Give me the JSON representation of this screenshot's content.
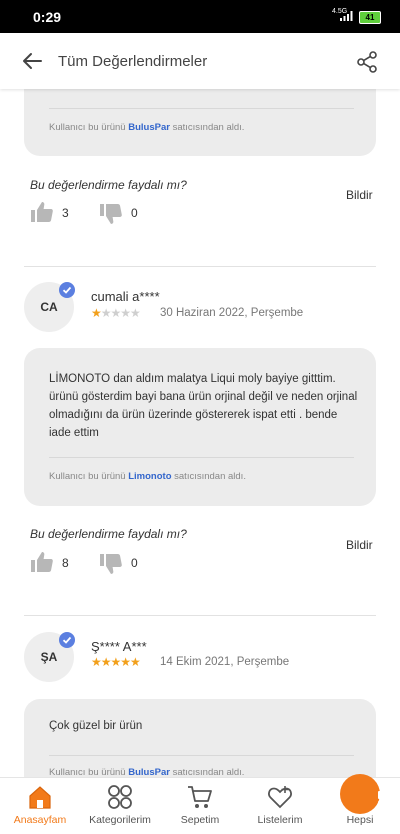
{
  "status_bar": {
    "time": "0:29",
    "network": "4.5G",
    "battery": "41"
  },
  "app_bar": {
    "title": "Tüm Değerlendirmeler"
  },
  "reviews": [
    {
      "seller_prefix": "Kullanıcı bu ürünü",
      "seller_name": "BulusPar",
      "seller_suffix": "satıcısından aldı.",
      "helpful_question": "Bu değerlendirme faydalı mı?",
      "report_label": "Bildir",
      "likes": "3",
      "dislikes": "0"
    },
    {
      "avatar": "CA",
      "author": "cumali a****",
      "rating": 1,
      "date": "30 Haziran 2022, Perşembe",
      "text": "LİMONOTO dan aldım malatya Liqui moly bayiye gitttim. ürünü gösterdim bayi bana ürün orjinal değil ve neden orjinal olmadığını da ürün üzerinde göstererek ispat etti . bende iade ettim",
      "seller_prefix": "Kullanıcı bu ürünü",
      "seller_name": "Limonoto",
      "seller_suffix": "satıcısından aldı.",
      "helpful_question": "Bu değerlendirme faydalı mı?",
      "report_label": "Bildir",
      "likes": "8",
      "dislikes": "0"
    },
    {
      "avatar": "ŞA",
      "author": "Ş**** A***",
      "rating": 5,
      "date": "14 Ekim 2021, Perşembe",
      "text": "Çok güzel bir ürün",
      "seller_prefix": "Kullanıcı bu ürünü",
      "seller_name": "BulusPar",
      "seller_suffix": "satıcısından aldı."
    }
  ],
  "bottom_nav": [
    {
      "label": "Anasayfam",
      "icon": "home-icon",
      "active": true
    },
    {
      "label": "Kategorilerim",
      "icon": "categories-icon",
      "active": false
    },
    {
      "label": "Sepetim",
      "icon": "cart-icon",
      "active": false
    },
    {
      "label": "Listelerim",
      "icon": "heart-list-icon",
      "active": false
    },
    {
      "label": "Hepsi",
      "icon": "hepsi-icon",
      "active": false
    }
  ],
  "colors": {
    "accent": "#f27a1a",
    "star": "#f2a01c",
    "link": "#3366cc",
    "verified": "#5b7fe0"
  }
}
